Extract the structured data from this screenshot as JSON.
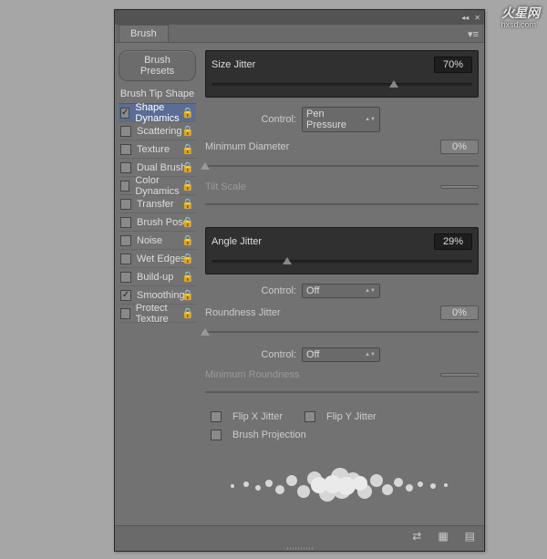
{
  "watermark": {
    "main": "火星网",
    "sub": "hxsd.com"
  },
  "panel": {
    "tab": "Brush",
    "presets_btn": "Brush Presets",
    "tip_shape": "Brush Tip Shape",
    "items": [
      {
        "label": "Shape Dynamics",
        "checked": true,
        "selected": true
      },
      {
        "label": "Scattering",
        "checked": false
      },
      {
        "label": "Texture",
        "checked": false
      },
      {
        "label": "Dual Brush",
        "checked": false
      },
      {
        "label": "Color Dynamics",
        "checked": false
      },
      {
        "label": "Transfer",
        "checked": false
      },
      {
        "label": "Brush Pose",
        "checked": false
      },
      {
        "label": "Noise",
        "checked": false
      },
      {
        "label": "Wet Edges",
        "checked": false
      },
      {
        "label": "Build-up",
        "checked": false
      },
      {
        "label": "Smoothing",
        "checked": true
      },
      {
        "label": "Protect Texture",
        "checked": false
      }
    ]
  },
  "right": {
    "size_jitter": {
      "label": "Size Jitter",
      "value": "70%"
    },
    "size_control": {
      "label": "Control:",
      "value": "Pen Pressure"
    },
    "min_diameter": {
      "label": "Minimum Diameter",
      "value": "0%"
    },
    "tilt_scale": {
      "label": "Tilt Scale"
    },
    "angle_jitter": {
      "label": "Angle Jitter",
      "value": "29%"
    },
    "angle_control": {
      "label": "Control:",
      "value": "Off"
    },
    "roundness_jitter": {
      "label": "Roundness Jitter",
      "value": "0%"
    },
    "roundness_control": {
      "label": "Control:",
      "value": "Off"
    },
    "min_roundness": {
      "label": "Minimum Roundness"
    },
    "flip_x": "Flip X Jitter",
    "flip_y": "Flip Y Jitter",
    "brush_projection": "Brush Projection"
  }
}
